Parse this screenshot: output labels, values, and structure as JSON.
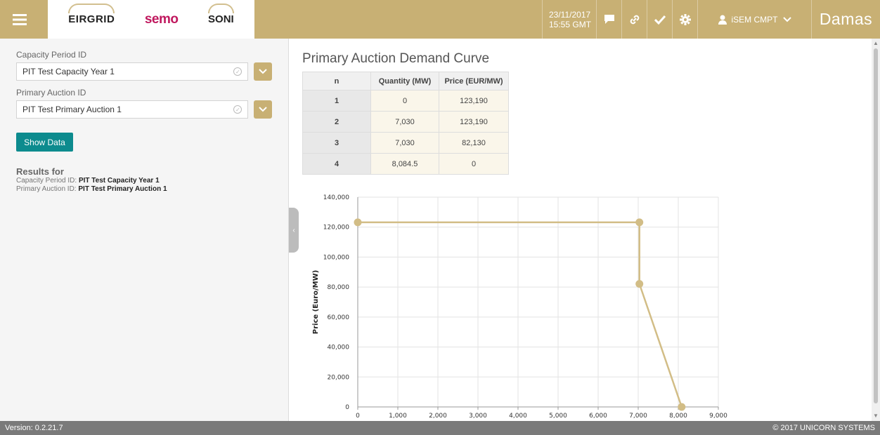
{
  "header": {
    "logos": {
      "eirgrid": "EIRGRID",
      "semo": "semo",
      "soni": "SONI"
    },
    "date": "23/11/2017",
    "time": "15:55 GMT",
    "user": "iSEM CMPT",
    "brand": "Damas",
    "accent_color": "#c8b074"
  },
  "left_panel": {
    "capacity_period": {
      "label": "Capacity Period ID",
      "value": "PIT Test Capacity Year 1"
    },
    "primary_auction": {
      "label": "Primary Auction ID",
      "value": "PIT Test Primary Auction 1"
    },
    "show_button": "Show Data",
    "results": {
      "title": "Results for",
      "capacity_label": "Capacity Period ID:",
      "capacity_value": "PIT Test Capacity Year 1",
      "auction_label": "Primary Auction ID:",
      "auction_value": "PIT Test Primary Auction 1"
    }
  },
  "main": {
    "title": "Primary Auction Demand Curve",
    "table": {
      "headers": [
        "n",
        "Quantity (MW)",
        "Price (EUR/MW)"
      ],
      "rows": [
        [
          "1",
          "0",
          "123,190"
        ],
        [
          "2",
          "7,030",
          "123,190"
        ],
        [
          "3",
          "7,030",
          "82,130"
        ],
        [
          "4",
          "8,084.5",
          "0"
        ]
      ]
    }
  },
  "chart_data": {
    "type": "line",
    "title": "",
    "xlabel": "",
    "ylabel": "Price (Euro/MW)",
    "x": [
      0,
      7030,
      7030,
      8084.5
    ],
    "y": [
      123190,
      123190,
      82130,
      0
    ],
    "xlim": [
      0,
      9000
    ],
    "ylim": [
      0,
      140000
    ],
    "xticks": [
      "0",
      "1,000",
      "2,000",
      "3,000",
      "4,000",
      "5,000",
      "6,000",
      "7,000",
      "8,000",
      "9,000"
    ],
    "yticks": [
      "0",
      "20,000",
      "40,000",
      "60,000",
      "80,000",
      "100,000",
      "120,000",
      "140,000"
    ],
    "grid": true,
    "color": "#d2bd86"
  },
  "footer": {
    "version": "Version: 0.2.21.7",
    "copyright": "© 2017 UNICORN SYSTEMS"
  }
}
